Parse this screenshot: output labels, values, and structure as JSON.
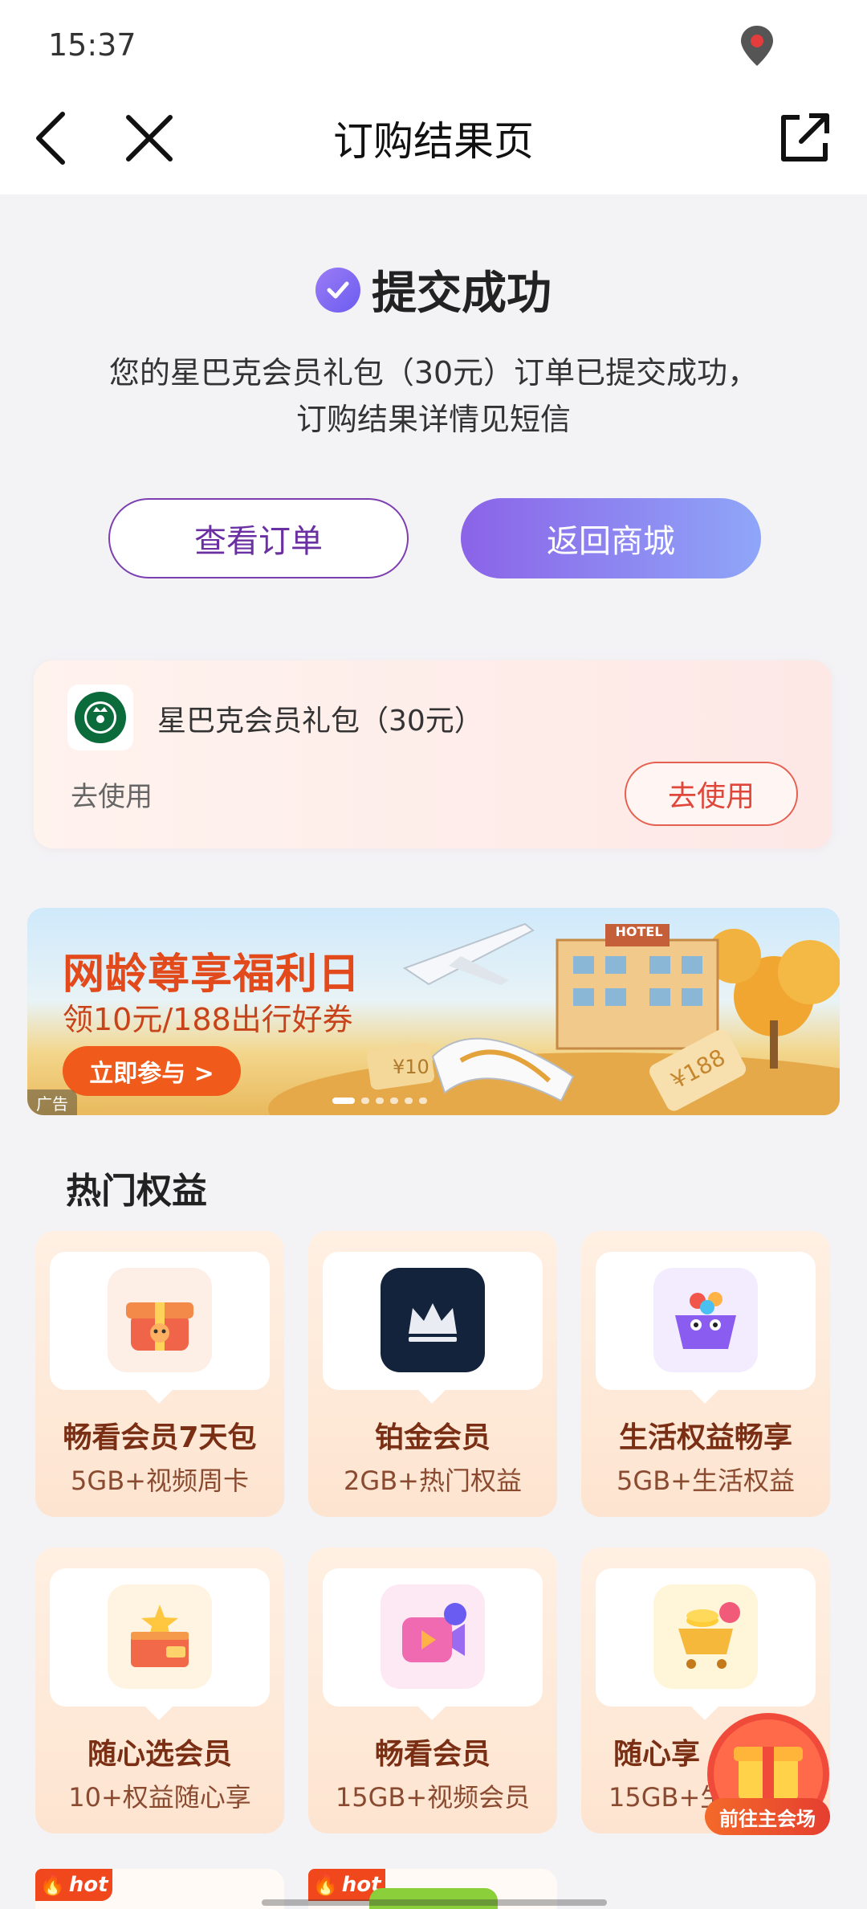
{
  "status_bar": {
    "time": "15:37"
  },
  "nav": {
    "title": "订购结果页",
    "back_icon": "chevron-left-icon",
    "close_icon": "close-icon",
    "share_icon": "share-icon"
  },
  "result": {
    "title": "提交成功",
    "description": "您的星巴克会员礼包（30元）订单已提交成功，订购结果详情见短信",
    "view_order_label": "查看订单",
    "back_to_mall_label": "返回商城"
  },
  "voucher": {
    "name": "星巴克会员礼包（30元）",
    "subtitle": "去使用",
    "button_label": "去使用"
  },
  "banner": {
    "title": "网龄尊享福利日",
    "subtitle": "领10元/188出行好券",
    "cta": "立即参与 >",
    "ad_tag": "广告",
    "price_tag_1": "¥10",
    "price_tag_2": "¥188",
    "hotel_sign": "HOTEL"
  },
  "benefits": {
    "section_title": "热门权益",
    "items": [
      {
        "title": "畅看会员7天包",
        "subtitle": "5GB+视频周卡",
        "icon": "gift-box-icon"
      },
      {
        "title": "铂金会员",
        "subtitle": "2GB+热门权益",
        "icon": "crown-icon"
      },
      {
        "title": "生活权益畅享",
        "subtitle": "5GB+生活权益",
        "icon": "basket-icon"
      },
      {
        "title": "随心选会员",
        "subtitle": "10+权益随心享",
        "icon": "vip-box-icon"
      },
      {
        "title": "畅看会员",
        "subtitle": "15GB+视频会员",
        "icon": "video-play-icon"
      },
      {
        "title": "随心享",
        "subtitle": "15GB+生",
        "icon": "cart-icon"
      }
    ],
    "hot_label": "hot"
  },
  "floating": {
    "label": "前往主会场"
  },
  "colors": {
    "accent": "#7d5cf0",
    "orange": "#f05a1a",
    "card_title": "#7a2f14"
  }
}
